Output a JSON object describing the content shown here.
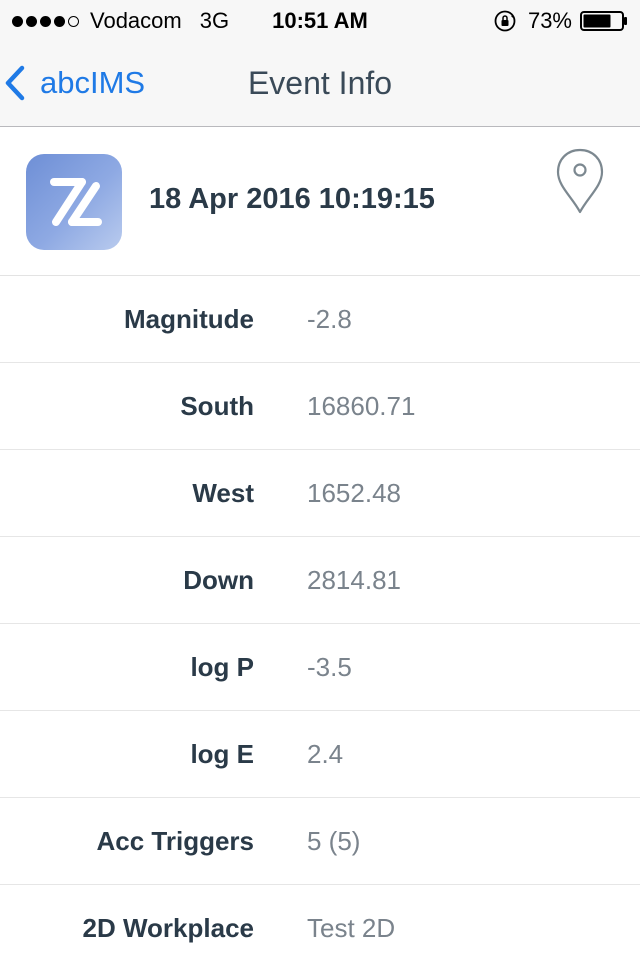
{
  "status_bar": {
    "signal_dots": 5,
    "signal_filled": 4,
    "carrier": "Vodacom",
    "network": "3G",
    "time": "10:51 AM",
    "battery_percent": "73%",
    "battery_level": 0.73,
    "lock_icon": "orientation-lock-icon"
  },
  "navbar": {
    "back_label": "abcIMS",
    "title": "Event Info",
    "accent_color": "#1f7ae6"
  },
  "header": {
    "app_icon": "app-logo-icon",
    "event_datetime": "18 Apr 2016 10:19:15",
    "location_icon": "location-pin-icon"
  },
  "details": [
    {
      "label": "Magnitude",
      "value": "-2.8"
    },
    {
      "label": "South",
      "value": "16860.71"
    },
    {
      "label": "West",
      "value": "1652.48"
    },
    {
      "label": "Down",
      "value": "2814.81"
    },
    {
      "label": "log P",
      "value": "-3.5"
    },
    {
      "label": "log E",
      "value": "2.4"
    },
    {
      "label": "Acc Triggers",
      "value": "5 (5)"
    },
    {
      "label": "2D Workplace",
      "value": "Test 2D"
    }
  ]
}
